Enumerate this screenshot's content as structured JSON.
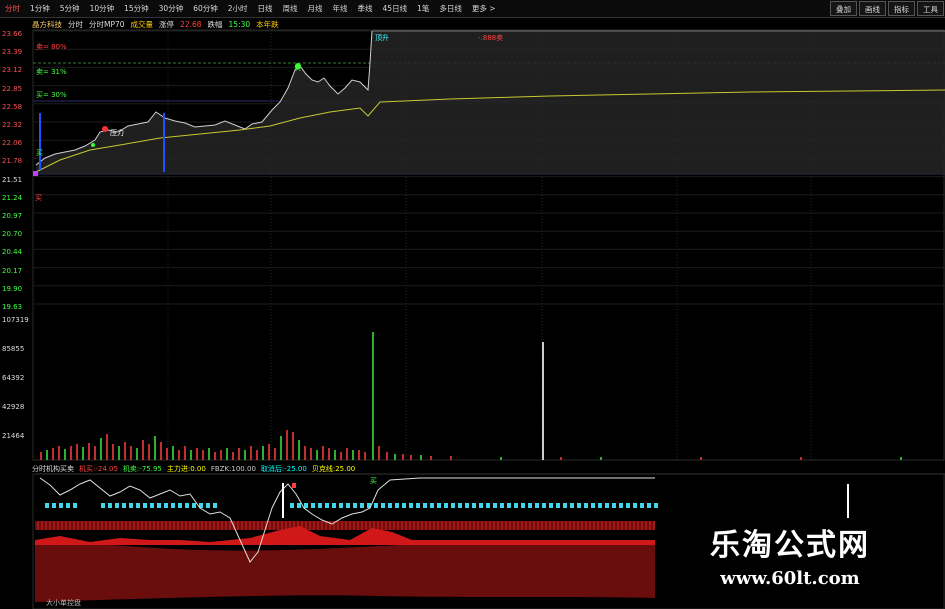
{
  "toolbar": {
    "periods": [
      "分时",
      "1分钟",
      "5分钟",
      "10分钟",
      "15分钟",
      "30分钟",
      "60分钟",
      "2小时",
      "日线",
      "周线",
      "月线",
      "年线",
      "季线",
      "45日线",
      "1笔",
      "多日线",
      "更多 >"
    ],
    "active_index": 0,
    "right_buttons": [
      "叠加",
      "画线",
      "指标",
      "工具"
    ]
  },
  "infobar": {
    "stock": "晶方科技",
    "items": [
      "分时",
      "分时MP70",
      "成交量",
      "涨停"
    ],
    "price": "22.68",
    "change_label": "跌幅",
    "time": "15:30",
    "extra": "本年跌"
  },
  "price_axis": [
    "23.66",
    "23.39",
    "23.12",
    "22.85",
    "22.58",
    "22.32",
    "22.06",
    "21.78",
    "21.51",
    "21.24",
    "20.97",
    "20.70",
    "20.44",
    "20.17",
    "19.90",
    "19.63"
  ],
  "volume_axis": [
    "107319",
    "85855",
    "64392",
    "42928",
    "21464"
  ],
  "annotations": {
    "sell_pct": "卖= 80%",
    "mid_pct": "卖= 31%",
    "buy_pct": "买= 30%",
    "top_tag": "顶升",
    "top_right_tag": "-.888卖",
    "top_peak": "卖",
    "left_buy": "买",
    "pressure": "压力",
    "left_mark": "买"
  },
  "indicator": {
    "name": "分时机构买卖",
    "items": [
      {
        "label": "机买:",
        "value": "-24.05",
        "color": "#ff4040"
      },
      {
        "label": "机卖:",
        "value": "-75.95",
        "color": "#40ff40"
      },
      {
        "label": "主力进:",
        "value": "0.00",
        "color": "#ffff00"
      },
      {
        "label": "FBZK:",
        "value": "100.00",
        "color": "#cccccc"
      },
      {
        "label": "取消后:",
        "value": "-25.00",
        "color": "#00ffff"
      },
      {
        "label": "贝克线:",
        "value": "25.00",
        "color": "#ffff00"
      }
    ],
    "bottom_label": "大小单控盘",
    "mark_buy": "买"
  },
  "colors": {
    "up": "#ff3030",
    "down": "#30ff30",
    "avg": "#c8c832",
    "price": "#d0d0d0",
    "grid": "#333333",
    "cyan": "#40d8e8"
  },
  "watermark": {
    "line1": "乐淘公式网",
    "line2": "www.60lt.com"
  }
}
